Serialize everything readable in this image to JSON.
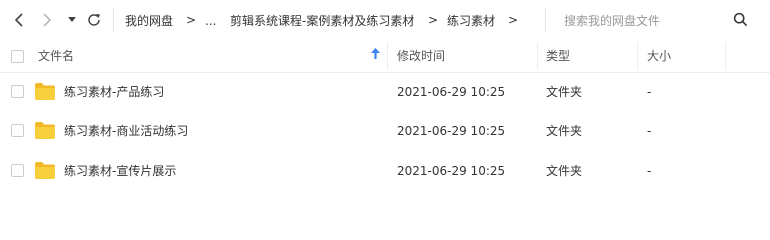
{
  "nav": {
    "breadcrumbs": [
      "我的网盘",
      "...",
      "剪辑系统课程-案例素材及练习素材",
      "练习素材"
    ],
    "separator": ">"
  },
  "search": {
    "placeholder": "搜索我的网盘文件"
  },
  "columns": {
    "name": "文件名",
    "modified": "修改时间",
    "type": "类型",
    "size": "大小"
  },
  "files": [
    {
      "name": "练习素材-产品练习",
      "modified": "2021-06-29 10:25",
      "type": "文件夹",
      "size": "-"
    },
    {
      "name": "练习素材-商业活动练习",
      "modified": "2021-06-29 10:25",
      "type": "文件夹",
      "size": "-"
    },
    {
      "name": "练习素材-宣传片展示",
      "modified": "2021-06-29 10:25",
      "type": "文件夹",
      "size": "-"
    }
  ],
  "colors": {
    "folder": "#f8cf3d",
    "folder_tab": "#f2b928",
    "sort_arrow": "#3b82f6"
  },
  "icons": [
    "back-icon",
    "forward-icon",
    "history-dropdown-icon",
    "refresh-icon",
    "search-icon",
    "sort-ascending-icon",
    "folder-icon"
  ]
}
